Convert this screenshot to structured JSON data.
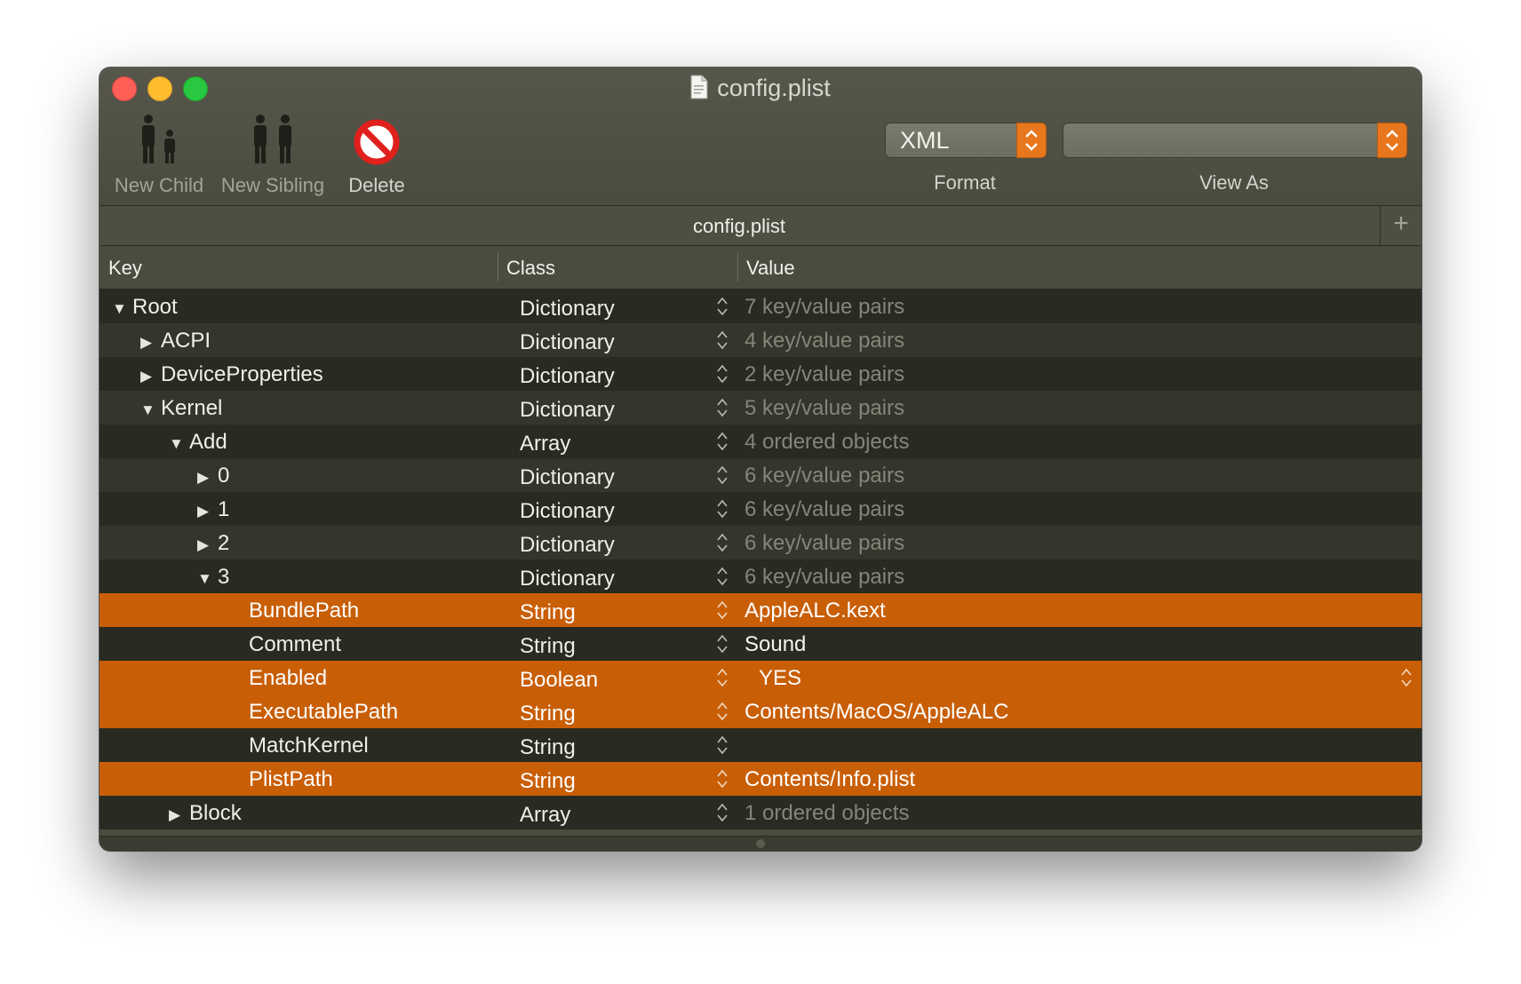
{
  "window": {
    "title": "config.plist"
  },
  "toolbar": {
    "new_child": "New Child",
    "new_sibling": "New Sibling",
    "delete": "Delete",
    "format_value": "XML",
    "format_label": "Format",
    "view_as_value": "",
    "view_as_label": "View As"
  },
  "tab": {
    "title": "config.plist",
    "add": "+"
  },
  "columns": {
    "key": "Key",
    "class": "Class",
    "value": "Value"
  },
  "colors": {
    "selection": "#c85e06",
    "accent": "#e8761c"
  },
  "rows": [
    {
      "key": "Root",
      "class": "Dictionary",
      "value": "7 key/value pairs",
      "disclosure": "expanded",
      "selected": false
    },
    {
      "key": "ACPI",
      "class": "Dictionary",
      "value": "4 key/value pairs",
      "disclosure": "collapsed",
      "selected": false
    },
    {
      "key": "DeviceProperties",
      "class": "Dictionary",
      "value": "2 key/value pairs",
      "disclosure": "collapsed",
      "selected": false
    },
    {
      "key": "Kernel",
      "class": "Dictionary",
      "value": "5 key/value pairs",
      "disclosure": "expanded",
      "selected": false
    },
    {
      "key": "Add",
      "class": "Array",
      "value": "4 ordered objects",
      "disclosure": "expanded",
      "selected": false
    },
    {
      "key": "0",
      "class": "Dictionary",
      "value": "6 key/value pairs",
      "disclosure": "collapsed",
      "selected": false
    },
    {
      "key": "1",
      "class": "Dictionary",
      "value": "6 key/value pairs",
      "disclosure": "collapsed",
      "selected": false
    },
    {
      "key": "2",
      "class": "Dictionary",
      "value": "6 key/value pairs",
      "disclosure": "collapsed",
      "selected": false
    },
    {
      "key": "3",
      "class": "Dictionary",
      "value": "6 key/value pairs",
      "disclosure": "expanded",
      "selected": false
    },
    {
      "key": "BundlePath",
      "class": "String",
      "value": "AppleALC.kext",
      "disclosure": "none",
      "selected": true
    },
    {
      "key": "Comment",
      "class": "String",
      "value": "Sound",
      "disclosure": "none",
      "selected": false
    },
    {
      "key": "Enabled",
      "class": "Boolean",
      "value": "YES",
      "disclosure": "none",
      "selected": true
    },
    {
      "key": "ExecutablePath",
      "class": "String",
      "value": "Contents/MacOS/AppleALC",
      "disclosure": "none",
      "selected": true
    },
    {
      "key": "MatchKernel",
      "class": "String",
      "value": "",
      "disclosure": "none",
      "selected": false
    },
    {
      "key": "PlistPath",
      "class": "String",
      "value": "Contents/Info.plist",
      "disclosure": "none",
      "selected": true
    },
    {
      "key": "Block",
      "class": "Array",
      "value": "1 ordered objects",
      "disclosure": "collapsed",
      "selected": false
    }
  ]
}
